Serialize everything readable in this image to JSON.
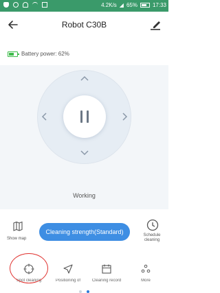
{
  "status_bar": {
    "network_speed": "4.2K/s",
    "battery_percent": "65%",
    "time": "17:33"
  },
  "header": {
    "title": "Robot C30B",
    "back_icon": "arrow-left-icon",
    "edit_icon": "edit-icon"
  },
  "battery": {
    "label": "Battery power: 62%",
    "level": 0.62,
    "color": "#3dbb4a"
  },
  "control": {
    "status": "Working",
    "center_icon": "pause-icon"
  },
  "actions": {
    "show_map": "Show map",
    "cleaning_strength": "Cleaning strength(Standard)",
    "schedule_cleaning": "Schedule cleaning"
  },
  "tabs": [
    {
      "label": "Spot cleaning",
      "icon": "crosshair-icon"
    },
    {
      "label": "Positioning of",
      "icon": "navigation-arrow-icon"
    },
    {
      "label": "Cleaning record",
      "icon": "calendar-icon"
    },
    {
      "label": "More",
      "icon": "more-dots-icon"
    }
  ],
  "pager": {
    "pages": 2,
    "active": 2
  },
  "colors": {
    "status_bar": "#3a9a6a",
    "accent": "#3e8ee3",
    "highlight": "#e0322f"
  }
}
